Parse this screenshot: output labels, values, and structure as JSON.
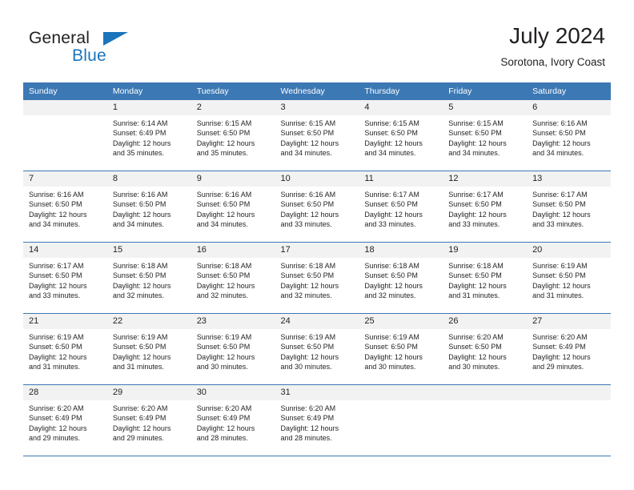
{
  "brand": {
    "name_part1": "General",
    "name_part2": "Blue"
  },
  "header": {
    "title": "July 2024",
    "subtitle": "Sorotona, Ivory Coast"
  },
  "colors": {
    "header_blue": "#3c78b4",
    "logo_blue": "#1b75bb",
    "daynum_band": "#f2f2f2",
    "text": "#231f20"
  },
  "weekdays": [
    "Sunday",
    "Monday",
    "Tuesday",
    "Wednesday",
    "Thursday",
    "Friday",
    "Saturday"
  ],
  "weeks": [
    [
      {
        "day": "",
        "empty": true
      },
      {
        "day": "1",
        "sunrise": "Sunrise: 6:14 AM",
        "sunset": "Sunset: 6:49 PM",
        "daylight1": "Daylight: 12 hours",
        "daylight2": "and 35 minutes."
      },
      {
        "day": "2",
        "sunrise": "Sunrise: 6:15 AM",
        "sunset": "Sunset: 6:50 PM",
        "daylight1": "Daylight: 12 hours",
        "daylight2": "and 35 minutes."
      },
      {
        "day": "3",
        "sunrise": "Sunrise: 6:15 AM",
        "sunset": "Sunset: 6:50 PM",
        "daylight1": "Daylight: 12 hours",
        "daylight2": "and 34 minutes."
      },
      {
        "day": "4",
        "sunrise": "Sunrise: 6:15 AM",
        "sunset": "Sunset: 6:50 PM",
        "daylight1": "Daylight: 12 hours",
        "daylight2": "and 34 minutes."
      },
      {
        "day": "5",
        "sunrise": "Sunrise: 6:15 AM",
        "sunset": "Sunset: 6:50 PM",
        "daylight1": "Daylight: 12 hours",
        "daylight2": "and 34 minutes."
      },
      {
        "day": "6",
        "sunrise": "Sunrise: 6:16 AM",
        "sunset": "Sunset: 6:50 PM",
        "daylight1": "Daylight: 12 hours",
        "daylight2": "and 34 minutes."
      }
    ],
    [
      {
        "day": "7",
        "sunrise": "Sunrise: 6:16 AM",
        "sunset": "Sunset: 6:50 PM",
        "daylight1": "Daylight: 12 hours",
        "daylight2": "and 34 minutes."
      },
      {
        "day": "8",
        "sunrise": "Sunrise: 6:16 AM",
        "sunset": "Sunset: 6:50 PM",
        "daylight1": "Daylight: 12 hours",
        "daylight2": "and 34 minutes."
      },
      {
        "day": "9",
        "sunrise": "Sunrise: 6:16 AM",
        "sunset": "Sunset: 6:50 PM",
        "daylight1": "Daylight: 12 hours",
        "daylight2": "and 34 minutes."
      },
      {
        "day": "10",
        "sunrise": "Sunrise: 6:16 AM",
        "sunset": "Sunset: 6:50 PM",
        "daylight1": "Daylight: 12 hours",
        "daylight2": "and 33 minutes."
      },
      {
        "day": "11",
        "sunrise": "Sunrise: 6:17 AM",
        "sunset": "Sunset: 6:50 PM",
        "daylight1": "Daylight: 12 hours",
        "daylight2": "and 33 minutes."
      },
      {
        "day": "12",
        "sunrise": "Sunrise: 6:17 AM",
        "sunset": "Sunset: 6:50 PM",
        "daylight1": "Daylight: 12 hours",
        "daylight2": "and 33 minutes."
      },
      {
        "day": "13",
        "sunrise": "Sunrise: 6:17 AM",
        "sunset": "Sunset: 6:50 PM",
        "daylight1": "Daylight: 12 hours",
        "daylight2": "and 33 minutes."
      }
    ],
    [
      {
        "day": "14",
        "sunrise": "Sunrise: 6:17 AM",
        "sunset": "Sunset: 6:50 PM",
        "daylight1": "Daylight: 12 hours",
        "daylight2": "and 33 minutes."
      },
      {
        "day": "15",
        "sunrise": "Sunrise: 6:18 AM",
        "sunset": "Sunset: 6:50 PM",
        "daylight1": "Daylight: 12 hours",
        "daylight2": "and 32 minutes."
      },
      {
        "day": "16",
        "sunrise": "Sunrise: 6:18 AM",
        "sunset": "Sunset: 6:50 PM",
        "daylight1": "Daylight: 12 hours",
        "daylight2": "and 32 minutes."
      },
      {
        "day": "17",
        "sunrise": "Sunrise: 6:18 AM",
        "sunset": "Sunset: 6:50 PM",
        "daylight1": "Daylight: 12 hours",
        "daylight2": "and 32 minutes."
      },
      {
        "day": "18",
        "sunrise": "Sunrise: 6:18 AM",
        "sunset": "Sunset: 6:50 PM",
        "daylight1": "Daylight: 12 hours",
        "daylight2": "and 32 minutes."
      },
      {
        "day": "19",
        "sunrise": "Sunrise: 6:18 AM",
        "sunset": "Sunset: 6:50 PM",
        "daylight1": "Daylight: 12 hours",
        "daylight2": "and 31 minutes."
      },
      {
        "day": "20",
        "sunrise": "Sunrise: 6:19 AM",
        "sunset": "Sunset: 6:50 PM",
        "daylight1": "Daylight: 12 hours",
        "daylight2": "and 31 minutes."
      }
    ],
    [
      {
        "day": "21",
        "sunrise": "Sunrise: 6:19 AM",
        "sunset": "Sunset: 6:50 PM",
        "daylight1": "Daylight: 12 hours",
        "daylight2": "and 31 minutes."
      },
      {
        "day": "22",
        "sunrise": "Sunrise: 6:19 AM",
        "sunset": "Sunset: 6:50 PM",
        "daylight1": "Daylight: 12 hours",
        "daylight2": "and 31 minutes."
      },
      {
        "day": "23",
        "sunrise": "Sunrise: 6:19 AM",
        "sunset": "Sunset: 6:50 PM",
        "daylight1": "Daylight: 12 hours",
        "daylight2": "and 30 minutes."
      },
      {
        "day": "24",
        "sunrise": "Sunrise: 6:19 AM",
        "sunset": "Sunset: 6:50 PM",
        "daylight1": "Daylight: 12 hours",
        "daylight2": "and 30 minutes."
      },
      {
        "day": "25",
        "sunrise": "Sunrise: 6:19 AM",
        "sunset": "Sunset: 6:50 PM",
        "daylight1": "Daylight: 12 hours",
        "daylight2": "and 30 minutes."
      },
      {
        "day": "26",
        "sunrise": "Sunrise: 6:20 AM",
        "sunset": "Sunset: 6:50 PM",
        "daylight1": "Daylight: 12 hours",
        "daylight2": "and 30 minutes."
      },
      {
        "day": "27",
        "sunrise": "Sunrise: 6:20 AM",
        "sunset": "Sunset: 6:49 PM",
        "daylight1": "Daylight: 12 hours",
        "daylight2": "and 29 minutes."
      }
    ],
    [
      {
        "day": "28",
        "sunrise": "Sunrise: 6:20 AM",
        "sunset": "Sunset: 6:49 PM",
        "daylight1": "Daylight: 12 hours",
        "daylight2": "and 29 minutes."
      },
      {
        "day": "29",
        "sunrise": "Sunrise: 6:20 AM",
        "sunset": "Sunset: 6:49 PM",
        "daylight1": "Daylight: 12 hours",
        "daylight2": "and 29 minutes."
      },
      {
        "day": "30",
        "sunrise": "Sunrise: 6:20 AM",
        "sunset": "Sunset: 6:49 PM",
        "daylight1": "Daylight: 12 hours",
        "daylight2": "and 28 minutes."
      },
      {
        "day": "31",
        "sunrise": "Sunrise: 6:20 AM",
        "sunset": "Sunset: 6:49 PM",
        "daylight1": "Daylight: 12 hours",
        "daylight2": "and 28 minutes."
      },
      {
        "day": "",
        "empty": true
      },
      {
        "day": "",
        "empty": true
      },
      {
        "day": "",
        "empty": true
      }
    ]
  ]
}
